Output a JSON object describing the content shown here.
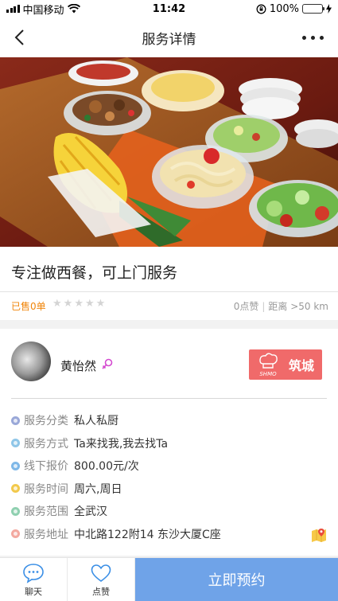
{
  "status_bar": {
    "carrier": "中国移动",
    "time": "11:42",
    "battery_percent": "100%",
    "battery_level": 1.0
  },
  "nav": {
    "title": "服务详情",
    "back_icon": "chevron-left-icon",
    "more_icon": "more-dots-icon"
  },
  "service": {
    "title": "专注做西餐，可上门服务",
    "sold": "已售0单",
    "rating": 0,
    "rating_max": 5,
    "likes": "0点赞",
    "distance": "距离 >50 km"
  },
  "provider": {
    "name": "黄怡然",
    "gender_icon": "female-icon",
    "shop_name": "筑城",
    "shop_logo_text": "SHMO"
  },
  "info": [
    {
      "label": "服务分类",
      "value": "私人私厨",
      "color": "#9aa8d8"
    },
    {
      "label": "服务方式",
      "value": "Ta来找我,我去找Ta",
      "color": "#8fc6e8"
    },
    {
      "label": "线下报价",
      "value": "800.00元/次",
      "color": "#7fb8e8"
    },
    {
      "label": "服务时间",
      "value": "周六,周日",
      "color": "#f2c94c"
    },
    {
      "label": "服务范围",
      "value": "全武汉",
      "color": "#8fd0b0"
    },
    {
      "label": "服务地址",
      "value": "中北路122附14 东沙大厦C座",
      "color": "#f3a9a0"
    }
  ],
  "bottom_bar": {
    "chat_label": "聊天",
    "like_label": "点赞",
    "book_label": "立即预约"
  },
  "colors": {
    "accent_orange": "#f0850a",
    "book_button": "#6fa3e8",
    "shop_badge": "#f06a6a",
    "icon_blue": "#3b8fe6"
  }
}
